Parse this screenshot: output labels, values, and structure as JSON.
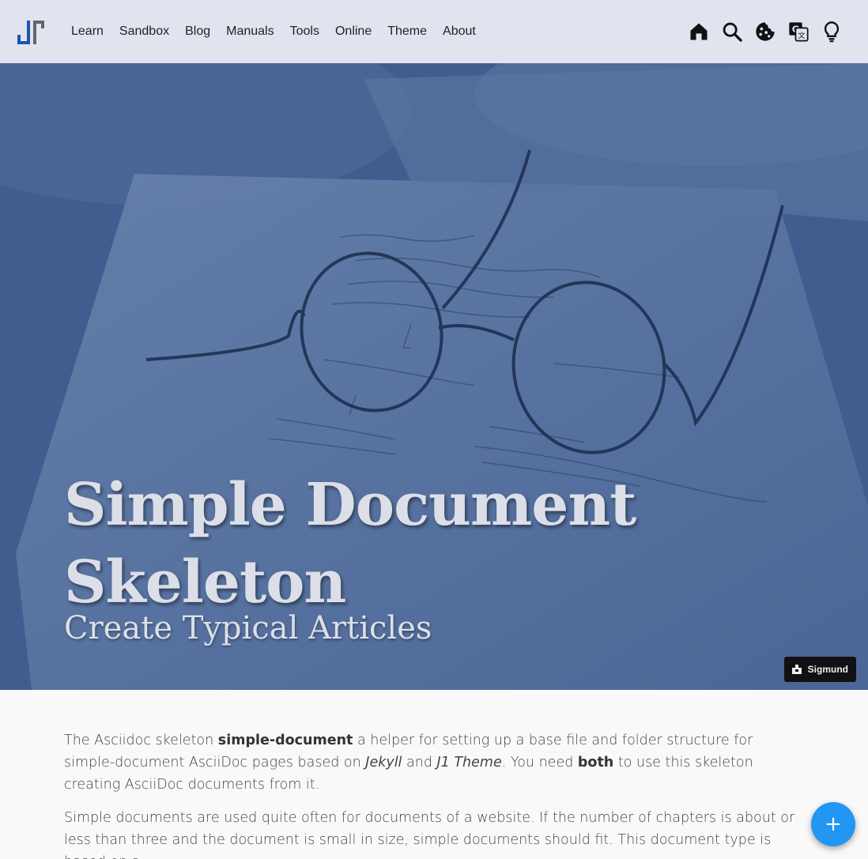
{
  "navbar": {
    "logo_name": "j1-logo",
    "links": [
      {
        "label": "Learn"
      },
      {
        "label": "Sandbox"
      },
      {
        "label": "Blog"
      },
      {
        "label": "Manuals"
      },
      {
        "label": "Tools"
      },
      {
        "label": "Online"
      },
      {
        "label": "Theme"
      },
      {
        "label": "About"
      }
    ],
    "icons": [
      "home-icon",
      "search-icon",
      "cookie-icon",
      "translate-icon",
      "lightbulb-icon"
    ]
  },
  "hero": {
    "title": "Simple Document Skeleton",
    "subtitle": "Create Typical Articles",
    "credit": "Sigmund",
    "overlay_color": "#3d5a8e",
    "credit_icon": "camera-icon"
  },
  "content": {
    "p1": {
      "t1": "The Asciidoc skeleton ",
      "b1": "simple-document",
      "t2": " a helper for setting up a base file and folder structure for simple-document AsciiDoc pages based on ",
      "i1": "Jekyll",
      "t3": " and ",
      "i2": "J1 Theme",
      "t4": ". You need ",
      "b2": "both",
      "t5": " to use this skeleton creating AsciiDoc documents from it."
    },
    "p2": "Simple documents are used quite often for documents of a website. If the number of chapters is about or less than three and the document is small in size, simple documents should fit. This document type is based on a"
  },
  "fab": {
    "label": "+",
    "icon": "plus-icon"
  },
  "colors": {
    "navbar_bg": "#e1e4ef",
    "fab": "#2196f3",
    "logo_blue": "#1a56b0",
    "logo_gray": "#666666"
  }
}
